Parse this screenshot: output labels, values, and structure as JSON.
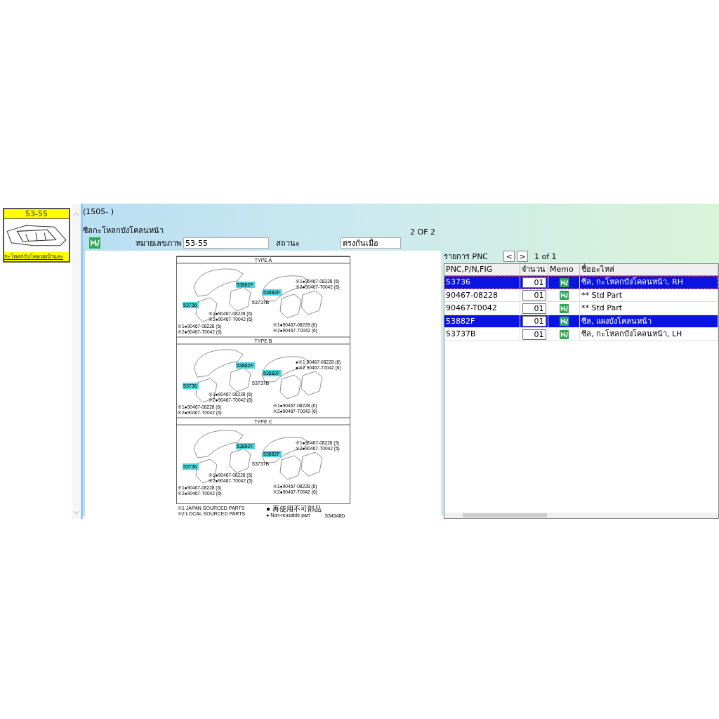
{
  "thumbnail": {
    "code": "53-55",
    "caption": "กะโหลกบังโคลนหน้าและ"
  },
  "header": {
    "date_range": "(1505-    )",
    "title": "ซีลกะโหลกบังโคลนหน้า",
    "page": "2 OF  2",
    "picture_no_label": "หมายเลขภาพ",
    "picture_no": "53-55",
    "status_label": "สถานะ",
    "status": "ตรงกันเมื่อ"
  },
  "diagram": {
    "sections": [
      {
        "title": "TYPE A",
        "callouts": [
          {
            "text": "53736",
            "highlighted": true
          },
          {
            "text": "53882F",
            "highlighted": true
          },
          {
            "text": "53737B",
            "highlighted": false
          },
          {
            "text": "53882F",
            "highlighted": true
          }
        ],
        "notes": [
          [
            "※1●90467-08228 (6)",
            "※2●90467-T0042 (6)"
          ],
          [
            "※1●90467-08228 (6)",
            "※2●90467-T0042 (6)"
          ],
          [
            "※1●90467-08228 (6)",
            "※2●90467-T0042 (6)"
          ],
          [
            "※1●90467-08228 (6)",
            "※2●90467-T0042 (6)"
          ]
        ]
      },
      {
        "title": "TYPE B",
        "callouts": [
          {
            "text": "53736",
            "highlighted": true
          },
          {
            "text": "53882F",
            "highlighted": true
          },
          {
            "text": "53737B",
            "highlighted": false
          },
          {
            "text": "53882F",
            "highlighted": true
          }
        ],
        "notes": [
          [
            "●※1 90467-08228 (6)",
            "●※2 90467-T0042 (6)"
          ],
          [
            "※1●90467-08228 (6)",
            "※2●90467-T0042 (6)"
          ],
          [
            "※1●90467-08228 (6)",
            "※2●90467-T0042 (6)"
          ],
          [
            "※1●90467-08228 (6)",
            "※2●90467-T0042 (6)"
          ]
        ]
      },
      {
        "title": "TYPE C",
        "callouts": [
          {
            "text": "53736",
            "highlighted": true
          },
          {
            "text": "53882F",
            "highlighted": true
          },
          {
            "text": "53737B",
            "highlighted": false
          },
          {
            "text": "53882F",
            "highlighted": true
          }
        ],
        "notes": [
          [
            "※1●90467-08228 (5)",
            "※2●90467-T0042 (5)"
          ],
          [
            "※1●90467-08228 (5)",
            "※2●90467-T0042 (5)"
          ],
          [
            "※1●90467-08228 (6)",
            "※2●90467-T0042 (6)"
          ],
          [
            "※1●90467-08228 (6)",
            "※2●90467-T0042 (6)"
          ]
        ]
      }
    ],
    "legend": [
      "※1 JAPAN SOURCED PARTS",
      "※2 LOCAL SOURCED PARTS"
    ],
    "symbols": [
      "● 再使用不可部品",
      "● Non-reusable part"
    ],
    "code": "534548D"
  },
  "pnc": {
    "label": "รายการ PNC",
    "prev": "<",
    "next": ">",
    "page": "1 of 1",
    "columns": [
      "PNC,P/N,FIG",
      "จำนวน",
      "Memo",
      "ชื่ออะไหล่"
    ],
    "rows": [
      {
        "pnc": "53736",
        "qty": "01",
        "name": "ซีล, กะโหลกบังโคลนหน้า, RH",
        "selected": true,
        "focused": true
      },
      {
        "pnc": "90467-08228",
        "qty": "01",
        "name": "** Std Part",
        "selected": false,
        "focused": false
      },
      {
        "pnc": "90467-T0042",
        "qty": "01",
        "name": "** Std Part",
        "selected": false,
        "focused": false
      },
      {
        "pnc": "53882F",
        "qty": "01",
        "name": "ซีล, แผงบังโคลนหน้า",
        "selected": true,
        "focused": false
      },
      {
        "pnc": "53737B",
        "qty": "01",
        "name": "ซีล, กะโหลกบังโคลนหน้า, LH",
        "selected": false,
        "focused": false
      }
    ]
  }
}
